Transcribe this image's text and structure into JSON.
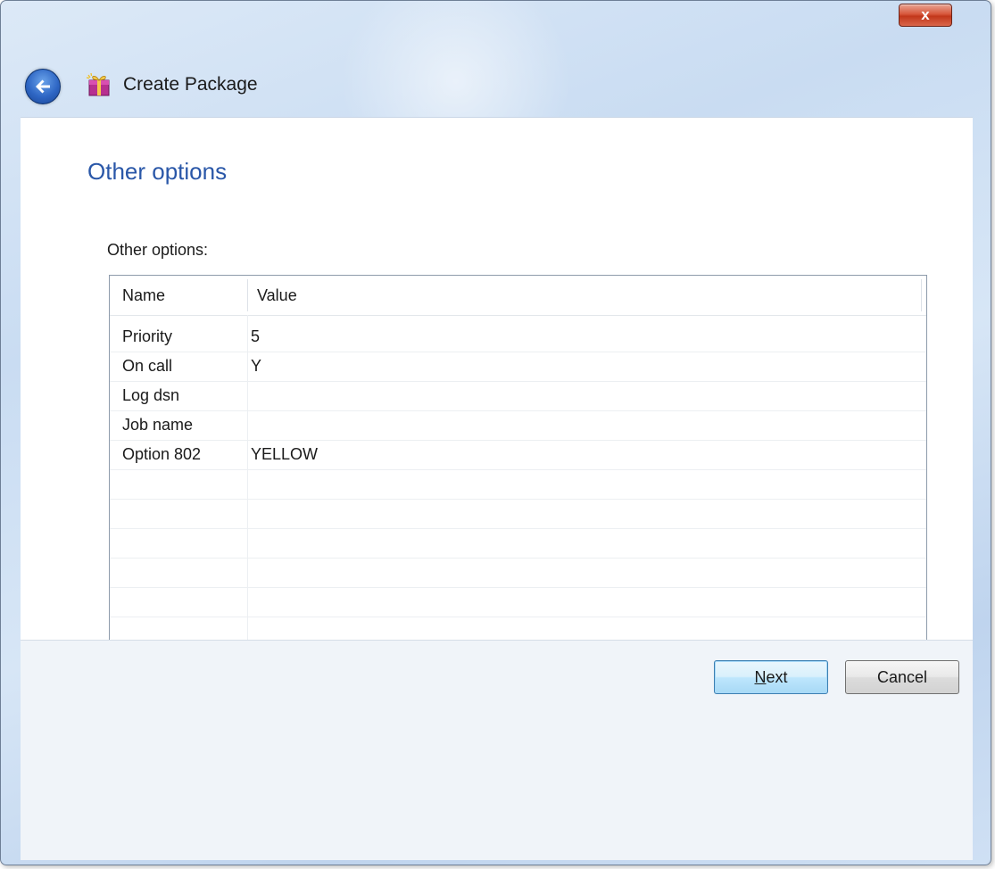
{
  "window": {
    "title": "Create Package",
    "close_label": "x"
  },
  "page": {
    "title": "Other options",
    "group_label": "Other options:"
  },
  "table": {
    "columns": [
      "Name",
      "Value"
    ],
    "rows": [
      {
        "name": "Priority",
        "value": "5"
      },
      {
        "name": "On call",
        "value": "Y"
      },
      {
        "name": "Log dsn",
        "value": ""
      },
      {
        "name": "Job name",
        "value": ""
      },
      {
        "name": "Option 802",
        "value": "YELLOW"
      }
    ]
  },
  "buttons": {
    "next_label": "Next",
    "next_mnemonic": "N",
    "cancel_label": "Cancel"
  },
  "icons": {
    "back": "back-arrow-icon",
    "package": "package-icon",
    "close": "close-icon"
  }
}
